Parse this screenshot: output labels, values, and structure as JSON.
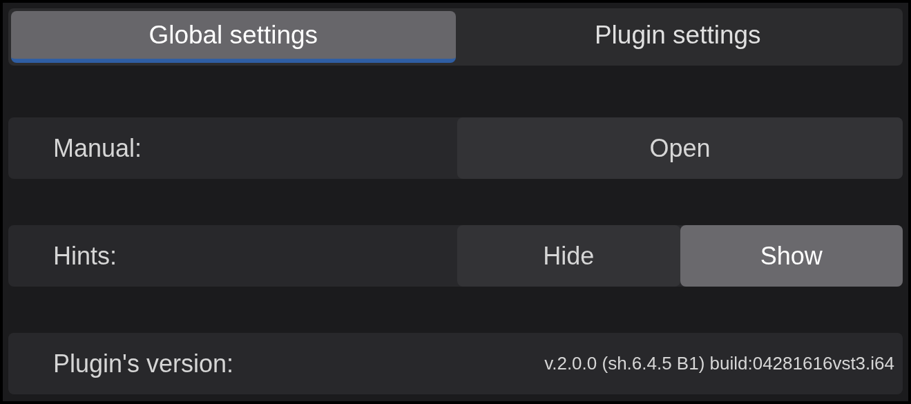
{
  "tabs": [
    {
      "label": "Global settings",
      "selected": true
    },
    {
      "label": "Plugin settings",
      "selected": false
    }
  ],
  "rows": [
    {
      "kind": "button",
      "label": "Manual:",
      "button": "Open"
    },
    {
      "kind": "toggle",
      "label": "Hints:",
      "options": [
        {
          "label": "Hide",
          "selected": false
        },
        {
          "label": "Show",
          "selected": true
        }
      ]
    },
    {
      "kind": "info",
      "label": "Plugin's version:",
      "value": "v.2.0.0 (sh.6.4.5 B1) build:04281616vst3.i64"
    }
  ]
}
